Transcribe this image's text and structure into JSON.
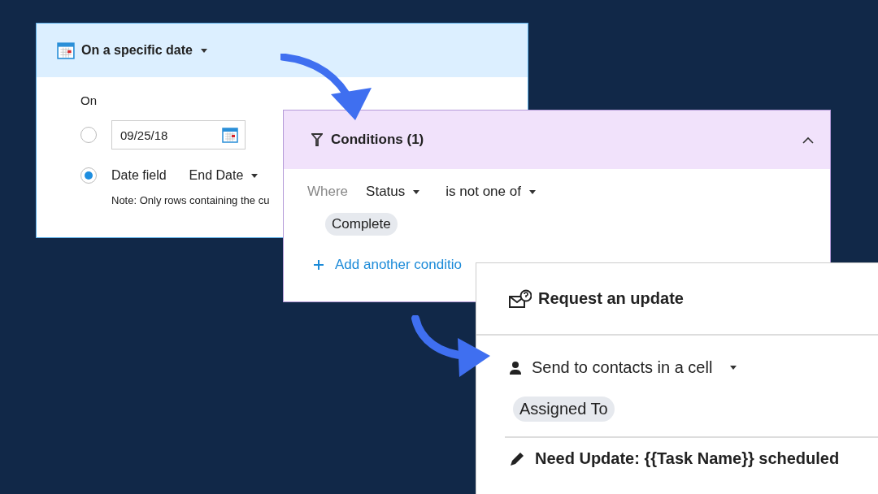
{
  "date_panel": {
    "trigger": "On a specific date",
    "on_label": "On",
    "options": [
      {
        "kind": "date",
        "selected": false,
        "value": "09/25/18"
      },
      {
        "kind": "field",
        "selected": true,
        "label": "Date field",
        "field": "End Date"
      }
    ],
    "note": "Note: Only rows containing the cu"
  },
  "conditions_panel": {
    "title": "Conditions (1)",
    "expanded": true,
    "where_label": "Where",
    "field": "Status",
    "operator": "is not one of",
    "values": [
      "Complete"
    ],
    "add_link": "Add another conditio"
  },
  "action_panel": {
    "title": "Request an update",
    "recipient_mode": "Send to contacts in a cell",
    "contacts": [
      "Assigned To"
    ],
    "subject": "Need Update: {{Task Name}} scheduled"
  }
}
